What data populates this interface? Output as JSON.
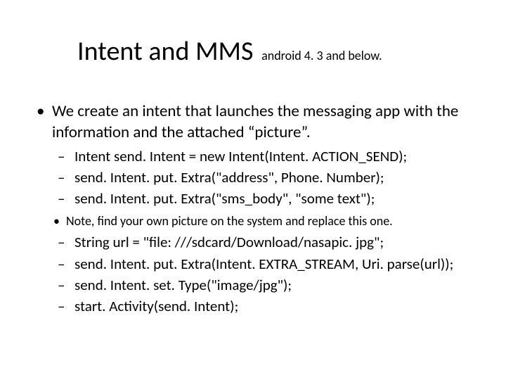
{
  "title": {
    "main": "Intent and MMS",
    "sub": "android 4. 3 and below."
  },
  "b1_items": [
    {
      "text": "We create an intent that launches the messaging app with the information and the attached “picture”."
    }
  ],
  "b2_items_a": [
    "Intent send. Intent = new Intent(Intent. ACTION_SEND);",
    "send. Intent. put. Extra(\"address\", Phone. Number);",
    "send. Intent. put. Extra(\"sms_body\", \"some text\");"
  ],
  "b3_items": [
    "Note, find your own picture on the system and replace this one."
  ],
  "b2_items_b": [
    "String url = \"file: ///sdcard/Download/nasapic. jpg\";",
    "send. Intent. put. Extra(Intent. EXTRA_STREAM, Uri. parse(url));",
    "send. Intent. set. Type(\"image/jpg\");",
    "start. Activity(send. Intent);"
  ]
}
